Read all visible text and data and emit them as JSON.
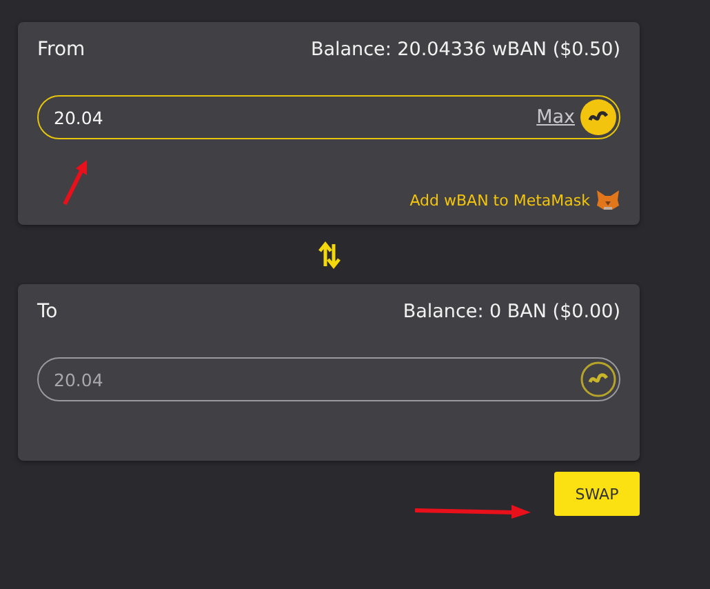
{
  "panels": [
    {
      "label": "From",
      "balance": "Balance: 20.04336 wBAN ($0.50)",
      "field": {
        "value": "20.04",
        "disabled": false,
        "max_link": "Max"
      },
      "metamask_link": "Add wBAN to MetaMask"
    },
    {
      "label": "To",
      "balance": "Balance: 0 BAN ($0.00)",
      "field": {
        "value": "20.04",
        "disabled": true
      }
    }
  ],
  "swap_button": "SWAP"
}
